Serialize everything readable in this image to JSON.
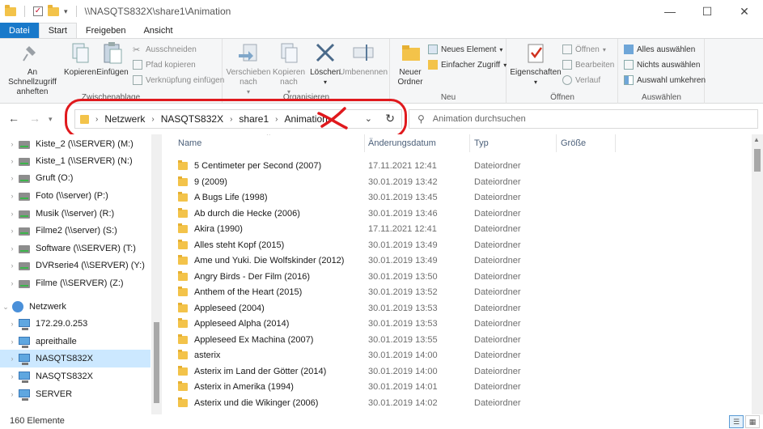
{
  "window": {
    "title": "\\\\NASQTS832X\\share1\\Animation",
    "controls": [
      "—",
      "☐",
      "✕"
    ]
  },
  "ribbon_tabs": [
    {
      "label": "Datei"
    },
    {
      "label": "Start"
    },
    {
      "label": "Freigeben"
    },
    {
      "label": "Ansicht"
    }
  ],
  "ribbon": {
    "zwischenablage": {
      "label": "Zwischenablage",
      "pin": "An Schnellzugriff anheften",
      "copy": "Kopieren",
      "paste": "Einfügen",
      "cut": "Ausschneiden",
      "copy_path": "Pfad kopieren",
      "paste_shortcut": "Verknüpfung einfügen"
    },
    "organisieren": {
      "label": "Organisieren",
      "move": "Verschieben nach",
      "copyto": "Kopieren nach",
      "delete": "Löschen",
      "rename": "Umbenennen"
    },
    "neu": {
      "label": "Neu",
      "new_folder": "Neuer Ordner",
      "new_item": "Neues Element",
      "easy_access": "Einfacher Zugriff"
    },
    "oeffnen": {
      "label": "Öffnen",
      "properties": "Eigenschaften",
      "open": "Öffnen",
      "edit": "Bearbeiten",
      "history": "Verlauf"
    },
    "auswaehlen": {
      "label": "Auswählen",
      "select_all": "Alles auswählen",
      "select_none": "Nichts auswählen",
      "invert": "Auswahl umkehren"
    }
  },
  "address": {
    "crumbs": [
      "Netzwerk",
      "NASQTS832X",
      "share1",
      "Animation"
    ],
    "search_placeholder": "Animation durchsuchen"
  },
  "nav": {
    "items": [
      {
        "label": "Kiste_2 (\\\\SERVER) (M:)",
        "kind": "drive"
      },
      {
        "label": "Kiste_1 (\\\\SERVER) (N:)",
        "kind": "drive"
      },
      {
        "label": "Gruft (O:)",
        "kind": "drive"
      },
      {
        "label": "Foto (\\\\server) (P:)",
        "kind": "drive"
      },
      {
        "label": "Musik (\\\\server) (R:)",
        "kind": "drive"
      },
      {
        "label": "Filme2 (\\\\server) (S:)",
        "kind": "drive"
      },
      {
        "label": "Software (\\\\SERVER) (T:)",
        "kind": "drive"
      },
      {
        "label": "DVRserie4 (\\\\SERVER) (Y:)",
        "kind": "drive"
      },
      {
        "label": "Filme (\\\\SERVER) (Z:)",
        "kind": "drive"
      },
      {
        "label": "Netzwerk",
        "kind": "network"
      },
      {
        "label": "172.29.0.253",
        "kind": "pc"
      },
      {
        "label": "apreithalle",
        "kind": "pc"
      },
      {
        "label": "NASQTS832X",
        "kind": "pc",
        "selected": true
      },
      {
        "label": "NASQTS832X",
        "kind": "pc"
      },
      {
        "label": "SERVER",
        "kind": "pc"
      }
    ]
  },
  "columns": {
    "name": "Name",
    "date": "Änderungsdatum",
    "type": "Typ",
    "size": "Größe"
  },
  "files": [
    {
      "name": "5 Centimeter per Second (2007)",
      "date": "17.11.2021 12:41",
      "type": "Dateiordner"
    },
    {
      "name": "9 (2009)",
      "date": "30.01.2019 13:42",
      "type": "Dateiordner"
    },
    {
      "name": "A Bugs Life (1998)",
      "date": "30.01.2019 13:45",
      "type": "Dateiordner"
    },
    {
      "name": "Ab durch die Hecke (2006)",
      "date": "30.01.2019 13:46",
      "type": "Dateiordner"
    },
    {
      "name": "Akira (1990)",
      "date": "17.11.2021 12:41",
      "type": "Dateiordner"
    },
    {
      "name": "Alles steht Kopf (2015)",
      "date": "30.01.2019 13:49",
      "type": "Dateiordner"
    },
    {
      "name": "Ame und Yuki. Die Wolfskinder (2012)",
      "date": "30.01.2019 13:49",
      "type": "Dateiordner"
    },
    {
      "name": "Angry Birds - Der Film (2016)",
      "date": "30.01.2019 13:50",
      "type": "Dateiordner"
    },
    {
      "name": "Anthem of the Heart (2015)",
      "date": "30.01.2019 13:52",
      "type": "Dateiordner"
    },
    {
      "name": "Appleseed (2004)",
      "date": "30.01.2019 13:53",
      "type": "Dateiordner"
    },
    {
      "name": "Appleseed Alpha (2014)",
      "date": "30.01.2019 13:53",
      "type": "Dateiordner"
    },
    {
      "name": "Appleseed Ex Machina (2007)",
      "date": "30.01.2019 13:55",
      "type": "Dateiordner"
    },
    {
      "name": "asterix",
      "date": "30.01.2019 14:00",
      "type": "Dateiordner"
    },
    {
      "name": "Asterix im Land der Götter (2014)",
      "date": "30.01.2019 14:00",
      "type": "Dateiordner"
    },
    {
      "name": "Asterix in Amerika (1994)",
      "date": "30.01.2019 14:01",
      "type": "Dateiordner"
    },
    {
      "name": "Asterix und die Wikinger (2006)",
      "date": "30.01.2019 14:02",
      "type": "Dateiordner"
    }
  ],
  "status": {
    "count": "160 Elemente"
  },
  "colors": {
    "accent": "#1979ca",
    "annotation": "#e0191d",
    "folder": "#f3c34a",
    "selection": "#cce8ff"
  }
}
